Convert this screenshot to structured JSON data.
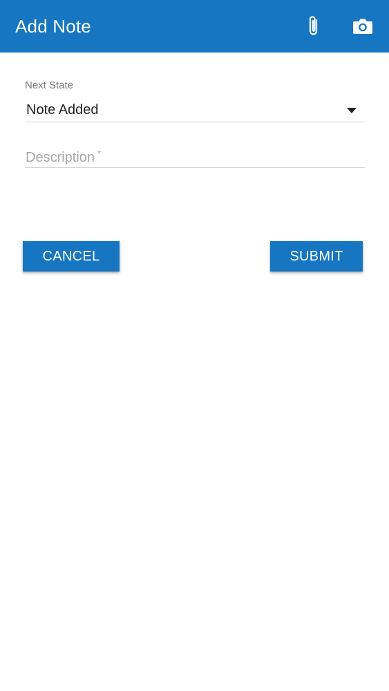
{
  "app_bar": {
    "title": "Add Note",
    "background_color": "#1676c1",
    "actions": [
      {
        "icon": "paperclip-icon",
        "label": "Attach"
      },
      {
        "icon": "camera-icon",
        "label": "Camera"
      }
    ]
  },
  "form": {
    "next_state": {
      "label": "Next State",
      "selected_value": "Note Added"
    },
    "description": {
      "placeholder": "Description",
      "required_marker": "*",
      "value": ""
    }
  },
  "buttons": {
    "cancel_label": "CANCEL",
    "submit_label": "SUBMIT",
    "color": "#1676c1"
  }
}
